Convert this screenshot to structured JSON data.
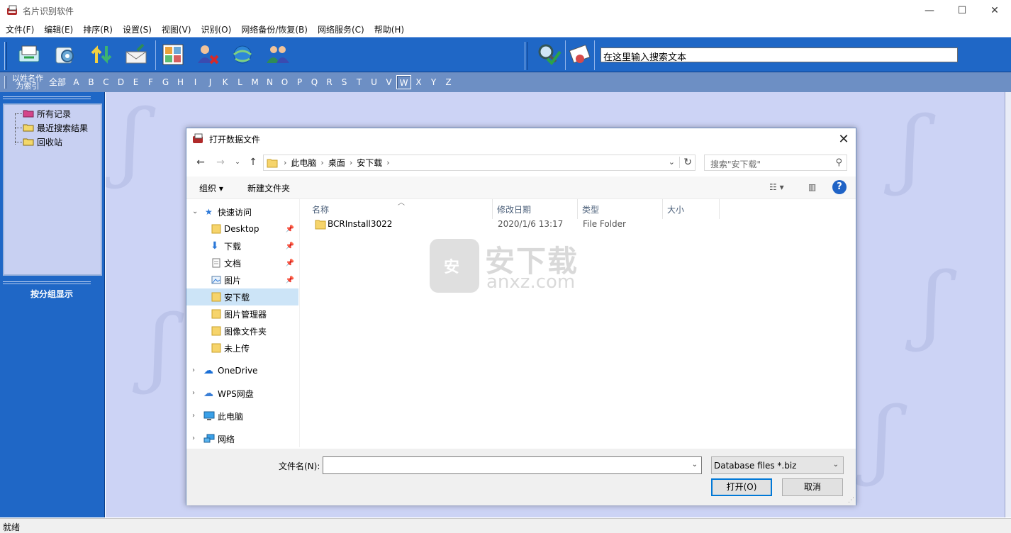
{
  "app": {
    "title": "名片识别软件",
    "window_controls": {
      "minimize": "—",
      "maximize": "☐",
      "close": "✕"
    }
  },
  "menu": [
    "文件(F)",
    "编辑(E)",
    "排序(R)",
    "设置(S)",
    "视图(V)",
    "识别(O)",
    "网络备份/恢复(B)",
    "网络服务(C)",
    "帮助(H)"
  ],
  "toolbar": {
    "buttons": [
      "scan-card-icon",
      "camera-icon",
      "sort-icon",
      "email-icon",
      "layout-icon",
      "delete-user-icon",
      "network-icon",
      "contacts-icon",
      "search-check-icon",
      "vcard-icon"
    ],
    "search_value": "在这里输入搜索文本"
  },
  "alphabar": {
    "label": "以姓名作为索引",
    "all": "全部",
    "letters": [
      "A",
      "B",
      "C",
      "D",
      "E",
      "F",
      "G",
      "H",
      "I",
      "J",
      "K",
      "L",
      "M",
      "N",
      "O",
      "P",
      "Q",
      "R",
      "S",
      "T",
      "U",
      "V",
      "W",
      "X",
      "Y",
      "Z"
    ],
    "selected": "W"
  },
  "sidebar": {
    "tree": [
      "所有记录",
      "最近搜索结果",
      "回收站"
    ],
    "group_title": "按分组显示"
  },
  "status": "就绪",
  "dialog": {
    "title": "打开数据文件",
    "breadcrumb": [
      "此电脑",
      "桌面",
      "安下载"
    ],
    "search_placeholder": "搜索\"安下载\"",
    "organize": "组织",
    "new_folder": "新建文件夹",
    "nav": {
      "quick_access": "快速访问",
      "items": [
        {
          "label": "Desktop",
          "pinned": true
        },
        {
          "label": "下载",
          "pinned": true
        },
        {
          "label": "文档",
          "pinned": true
        },
        {
          "label": "图片",
          "pinned": true
        },
        {
          "label": "安下载",
          "pinned": false,
          "selected": true
        },
        {
          "label": "图片管理器",
          "pinned": false
        },
        {
          "label": "图像文件夹",
          "pinned": false
        },
        {
          "label": "未上传",
          "pinned": false
        }
      ],
      "roots": [
        "OneDrive",
        "WPS网盘",
        "此电脑",
        "网络"
      ]
    },
    "columns": [
      "名称",
      "修改日期",
      "类型",
      "大小"
    ],
    "files": [
      {
        "name": "BCRInstall3022",
        "modified": "2020/1/6 13:17",
        "type": "File Folder",
        "size": ""
      }
    ],
    "watermark": {
      "text": "安下载",
      "url": "anxz.com",
      "badge": "安"
    },
    "filename_label": "文件名(N):",
    "filename_value": "",
    "filetype": "Database files *.biz",
    "open": "打开(O)",
    "cancel": "取消"
  },
  "colors": {
    "toolbar_blue": "#1f67c6",
    "alphabar": "#6d8fc4",
    "workspace": "#ccd3f5",
    "accent": "#0078d7"
  }
}
